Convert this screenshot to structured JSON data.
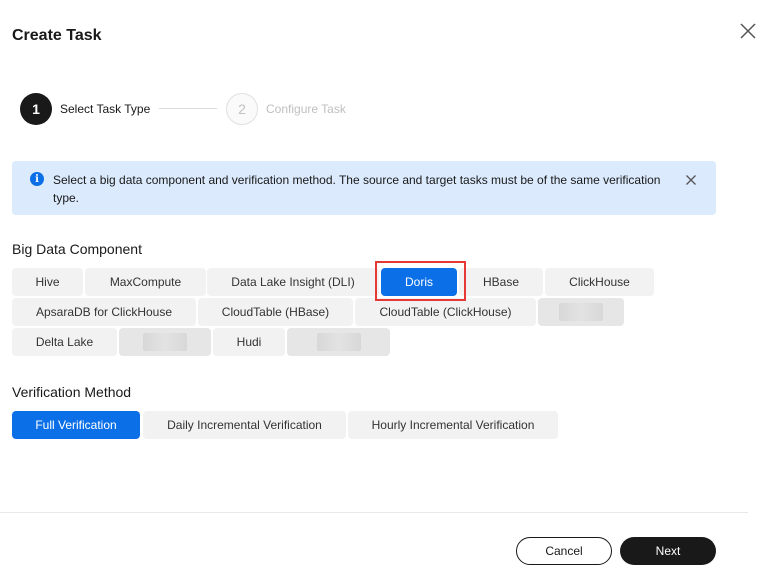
{
  "dialog": {
    "title": "Create Task",
    "close_icon": "close-icon"
  },
  "steps": [
    {
      "number": "1",
      "label": "Select Task Type",
      "state": "active"
    },
    {
      "number": "2",
      "label": "Configure Task",
      "state": "inactive"
    }
  ],
  "banner": {
    "icon": "info-icon",
    "text": "Select a big data component and verification method. The source and target tasks must be of the same verification type.",
    "close_icon": "close-icon"
  },
  "big_data_component": {
    "label": "Big Data Component",
    "options": [
      "Hive",
      "MaxCompute",
      "Data Lake Insight (DLI)",
      "Doris",
      "HBase",
      "ClickHouse",
      "ApsaraDB for ClickHouse",
      "CloudTable (HBase)",
      "CloudTable (ClickHouse)",
      "",
      "Delta Lake",
      "",
      "Hudi",
      ""
    ],
    "selected": "Doris"
  },
  "verification_method": {
    "label": "Verification Method",
    "options": [
      "Full Verification",
      "Daily Incremental Verification",
      "Hourly Incremental Verification"
    ],
    "selected": "Full Verification"
  },
  "footer": {
    "cancel_label": "Cancel",
    "next_label": "Next"
  },
  "colors": {
    "primary": "#0b6fe8",
    "dark": "#191919",
    "banner_bg": "#dbeafd",
    "highlight": "#e53935"
  }
}
